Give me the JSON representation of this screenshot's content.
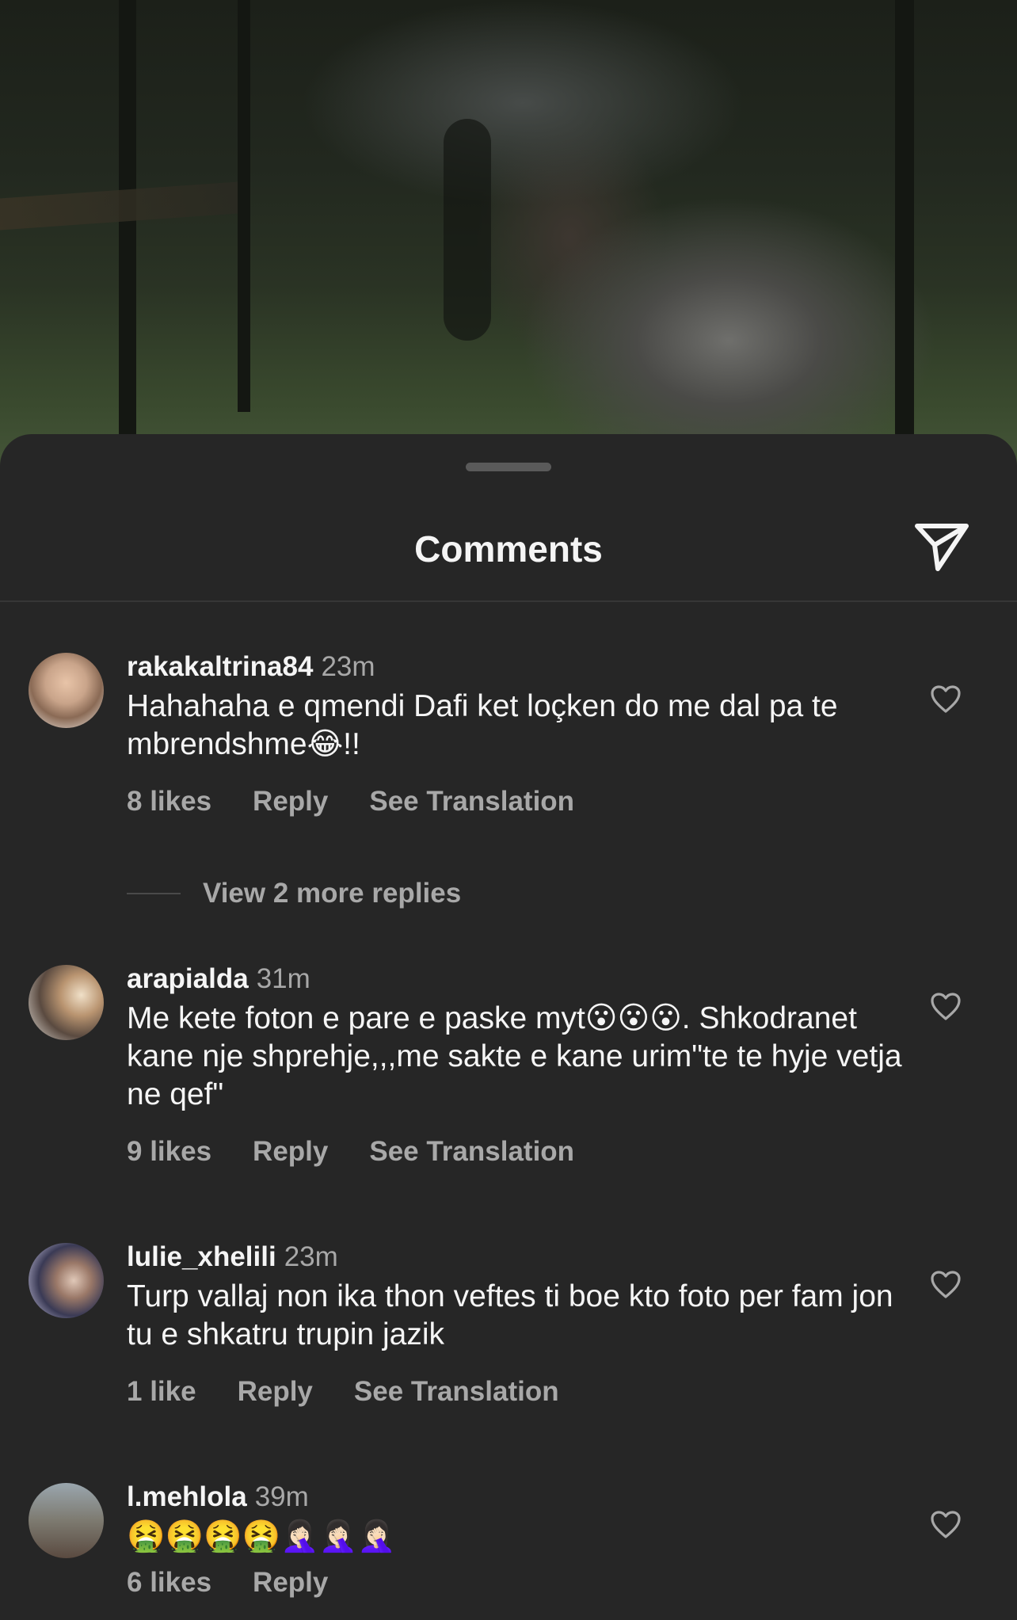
{
  "header": {
    "title": "Comments",
    "share_icon": "paper-plane-icon"
  },
  "comments": [
    {
      "username": "rakakaltrina84",
      "time": "23m",
      "text": "Hahahaha e qmendi  Dafi ket loçken do me dal pa te mbrendshme😂!!",
      "likes": "8 likes",
      "reply": "Reply",
      "translate": "See Translation"
    },
    {
      "username": "arapialda",
      "time": "31m",
      "text": "Me kete foton e pare e paske myt😮😮😮. Shkodranet kane nje shprehje,,,me sakte e kane urim\"te  te hyje vetja ne qef\"",
      "likes": "9 likes",
      "reply": "Reply",
      "translate": "See Translation"
    },
    {
      "username": "lulie_xhelili",
      "time": "23m",
      "text": "Turp vallaj non ika thon veftes ti boe kto foto per fam jon tu e shkatru trupin jazik",
      "likes": "1 like",
      "reply": "Reply",
      "translate": "See Translation"
    },
    {
      "username": "l.mehlola",
      "time": "39m",
      "text": "🤮🤮🤮🤮🤦🏻‍♀️🤦🏻‍♀️🤦🏻‍♀️",
      "likes": "6 likes",
      "reply": "Reply"
    }
  ],
  "view_replies": "View 2 more replies",
  "colors": {
    "background": "#262626",
    "secondary_text": "#a8a8a8",
    "primary_text": "#f5f5f5"
  }
}
